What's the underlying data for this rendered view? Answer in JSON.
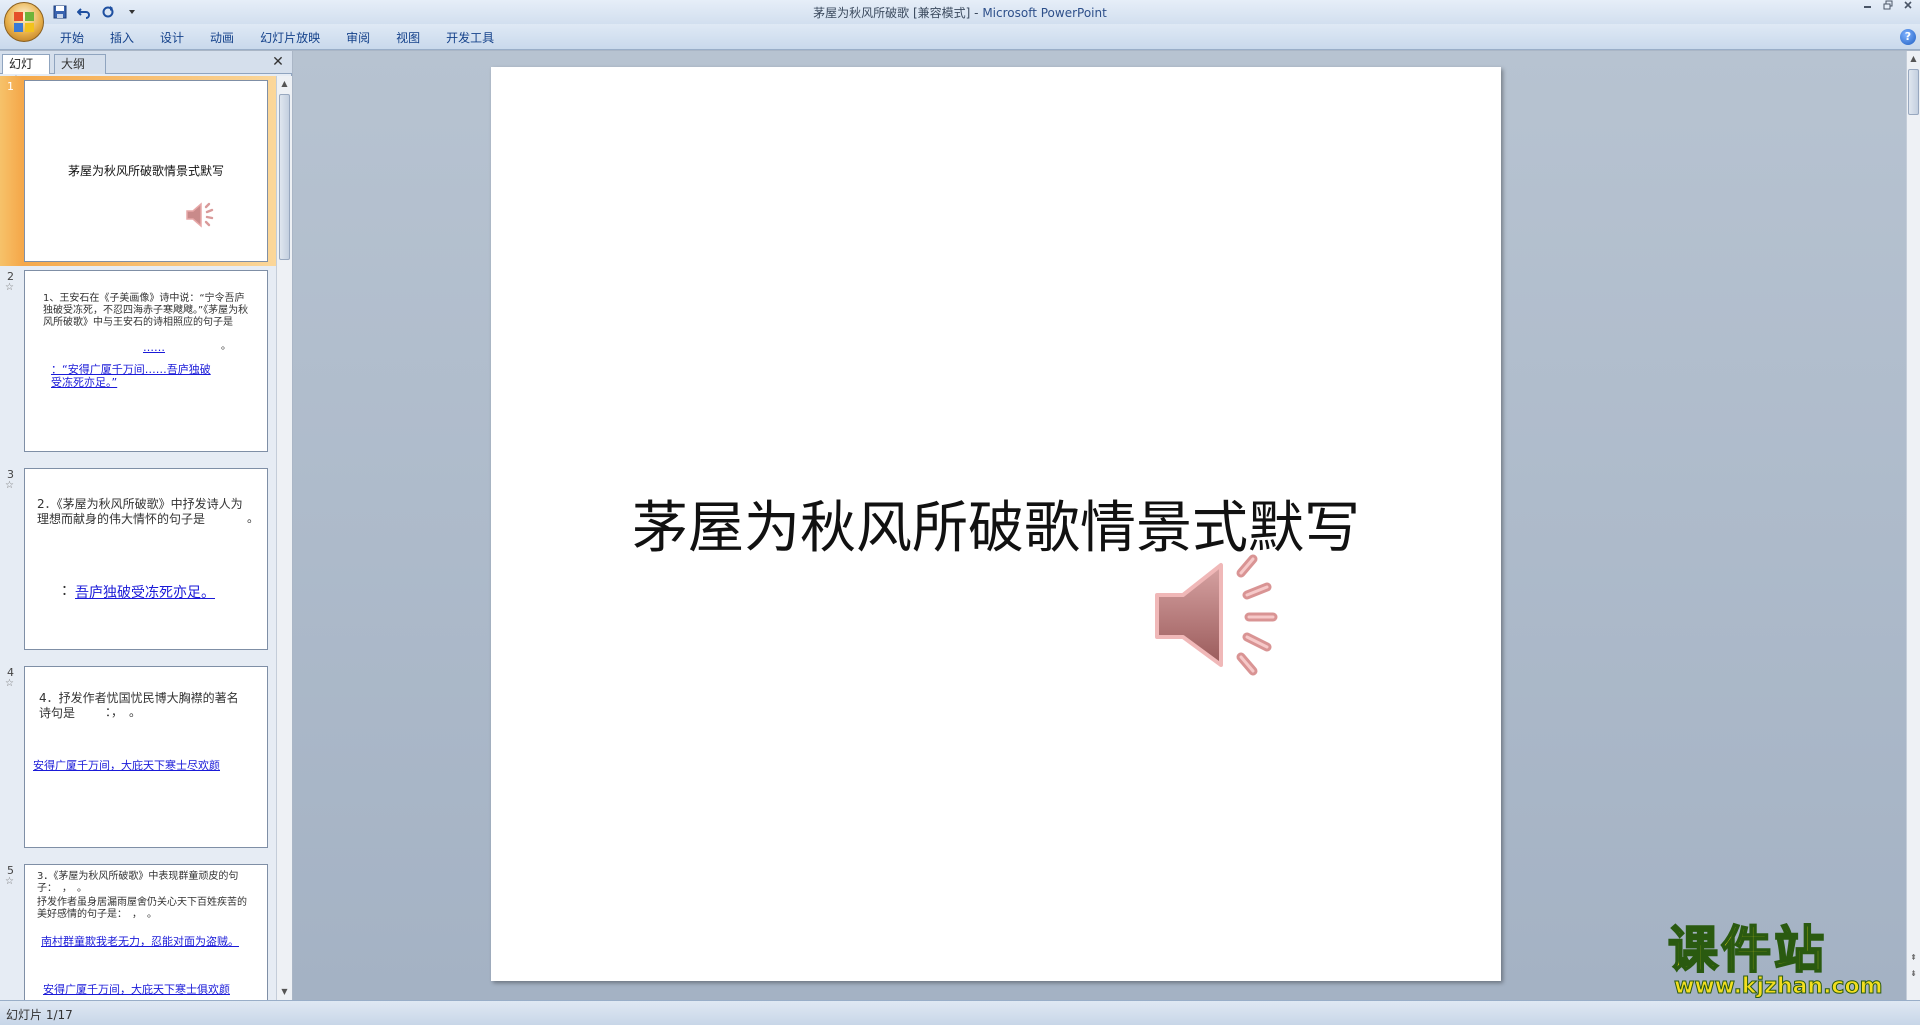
{
  "window": {
    "title_doc": "茅屋为秋风所破歌 [兼容模式]",
    "title_sep": " - ",
    "title_app": "Microsoft PowerPoint"
  },
  "quick_access": [
    "save-icon",
    "undo-icon",
    "redo-icon",
    "customize-dropdown-icon"
  ],
  "ribbon": {
    "tabs": [
      "开始",
      "插入",
      "设计",
      "动画",
      "幻灯片放映",
      "审阅",
      "视图",
      "开发工具"
    ],
    "help": "?"
  },
  "left_pane": {
    "tab_slides": "幻灯片",
    "tab_outline": "大纲",
    "close": "✕"
  },
  "thumbnails": [
    {
      "num": "1",
      "title": "茅屋为秋风所破歌情景式默写"
    },
    {
      "num": "2",
      "star": "☆",
      "text1": "1、王安石在《子美画像》诗中说：“宁令吾庐独破受冻死，不忍四海赤子寒飕飕。”《茅屋为秋风所破歌》中与王安石的诗相照应的句子是",
      "dots": "……",
      "period": "。",
      "answer": "：“安得广厦千万间……吾庐独破受冻死亦足。”"
    },
    {
      "num": "3",
      "star": "☆",
      "text1": "2．《茅屋为秋风所破歌》中抒发诗人为理想而献身的伟大情怀的句子是",
      "period": "。",
      "colon": "：",
      "answer": "吾庐独破受冻死亦足。"
    },
    {
      "num": "4",
      "star": "☆",
      "text1": "4．抒发作者忧国忧民博大胸襟的著名诗句是",
      "marks": "：，　。",
      "answer": "安得广厦千万间，大庇天下寒士尽欢颜"
    },
    {
      "num": "5",
      "star": "☆",
      "text1": "3．《茅屋为秋风所破歌》中表现群童顽皮的句子：　，　。",
      "text2": "抒发作者虽身居漏雨屋舍仍关心天下百姓疾苦的美好感情的句子是：　，　。",
      "answer1": "南村群童欺我老无力，忍能对面为盗贼。",
      "answer2": "安得广厦千万间，大庇天下寒士俱欢颜"
    }
  ],
  "slide": {
    "title": "茅屋为秋风所破歌情景式默写",
    "media": "speaker-icon"
  },
  "status": {
    "slide_info": "幻灯片 1/17"
  },
  "watermark": {
    "cn": "课件站",
    "url": "www.kjzhan.com"
  },
  "colors": {
    "selected_thumb": "#f5a84a",
    "link": "#1a1ad8",
    "speaker": "#cf8a8a"
  }
}
